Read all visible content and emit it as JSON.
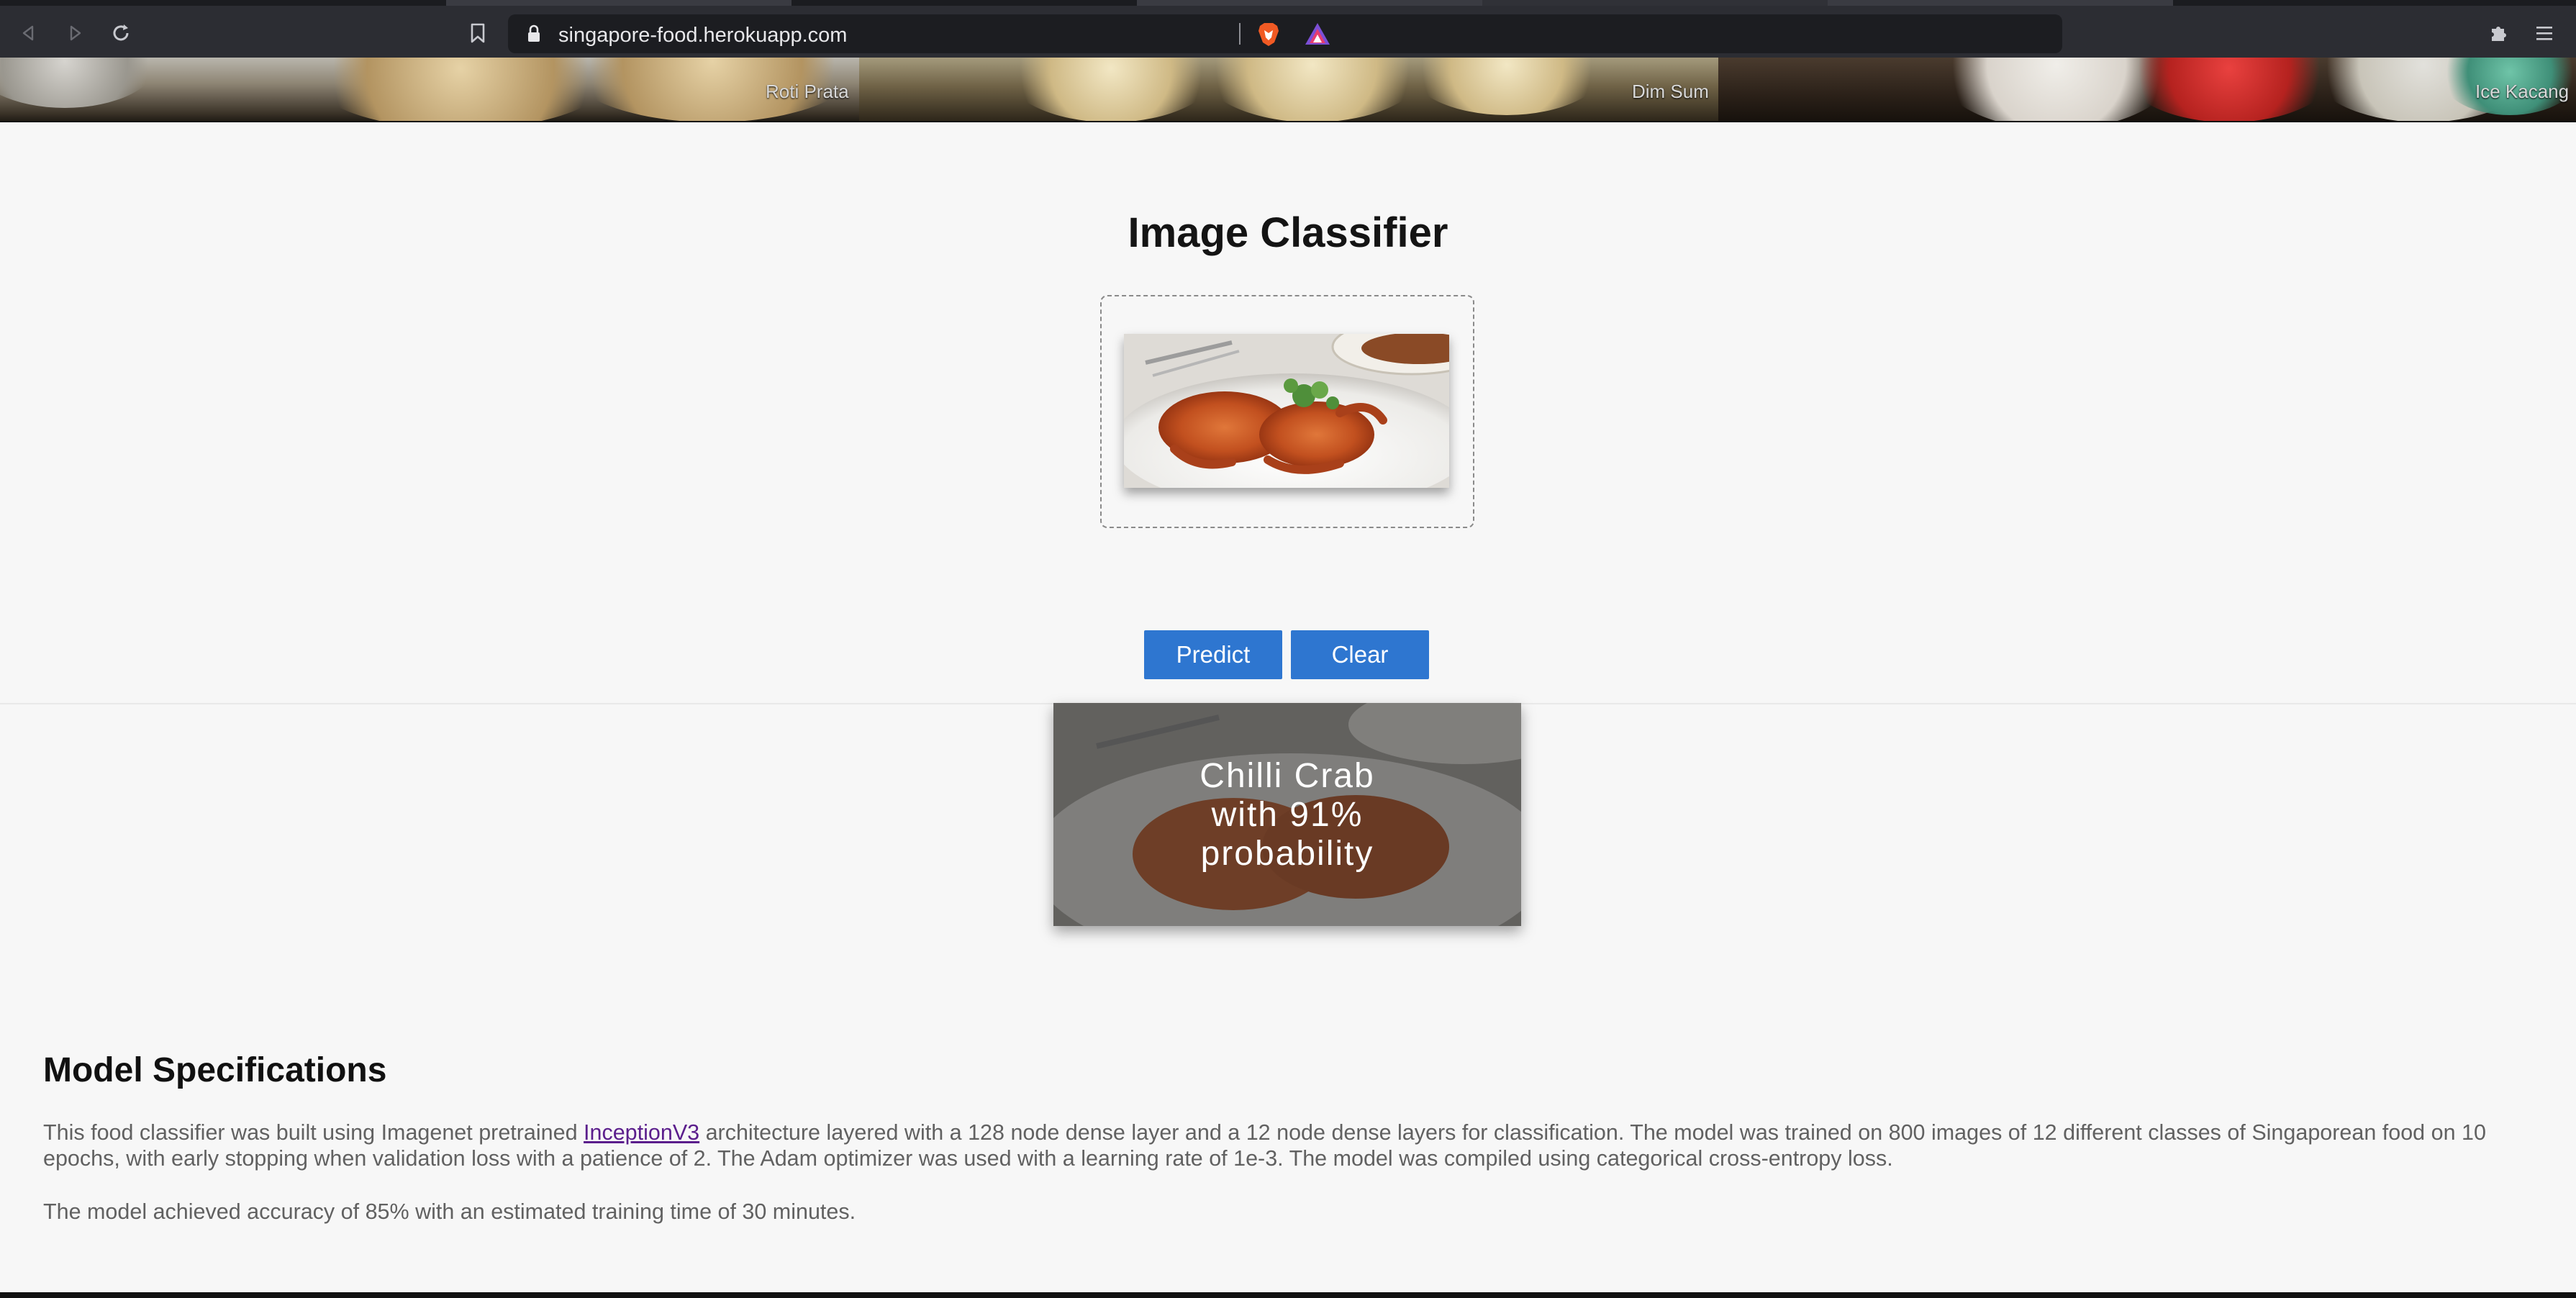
{
  "browser": {
    "url": "singapore-food.herokuapp.com",
    "icons": {
      "back": "back-arrow-icon",
      "forward": "forward-arrow-icon",
      "reload": "reload-icon",
      "bookmark": "bookmark-icon",
      "lock": "lock-icon",
      "brave": "brave-shields-icon",
      "rewards": "brave-rewards-icon",
      "extensions": "puzzle-icon",
      "menu": "hamburger-menu-icon"
    }
  },
  "banner": {
    "labels": [
      "Roti Prata",
      "Dim Sum",
      "Ice Kacang"
    ]
  },
  "main": {
    "title": "Image Classifier",
    "buttons": {
      "predict": "Predict",
      "clear": "Clear"
    },
    "result": {
      "line1": "Chilli Crab",
      "line2": "with 91%",
      "line3": "probability"
    }
  },
  "specs": {
    "title": "Model Specifications",
    "p1_before": "This food classifier was built using Imagenet pretrained ",
    "p1_link": "InceptionV3",
    "p1_after": " architecture layered with a 128 node dense layer and a 12 node dense layers for classification. The model was trained on 800 images of 12 different classes of Singaporean food on 10 epochs, with early stopping when validation loss with a patience of 2. The Adam optimizer was used with a learning rate of 1e-3. The model was compiled using categorical cross-entropy loss.",
    "p2": "The model achieved accuracy of 85% with an estimated training time of 30 minutes."
  },
  "colors": {
    "button": "#2e76d0",
    "link": "#5b1e8c",
    "page_bg": "#f7f7f7"
  }
}
